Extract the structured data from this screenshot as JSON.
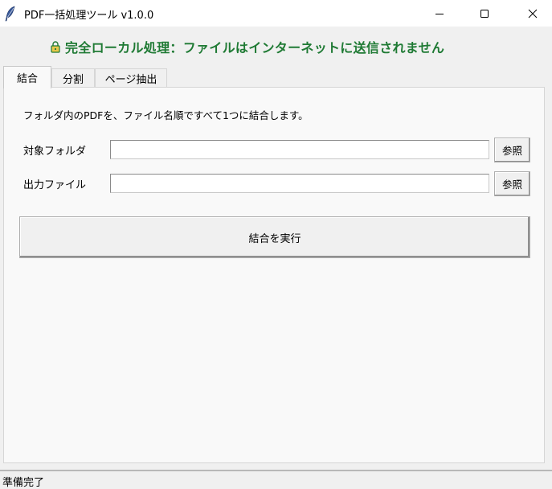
{
  "window": {
    "title": "PDF一括処理ツール v1.0.0",
    "icon": "feather-icon"
  },
  "banner": {
    "icon": "lock-icon",
    "text": "完全ローカル処理：ファイルはインターネットに送信されません",
    "color": "#1f7a34"
  },
  "tabs": [
    {
      "label": "結合",
      "active": true
    },
    {
      "label": "分割",
      "active": false
    },
    {
      "label": "ページ抽出",
      "active": false
    }
  ],
  "merge": {
    "description": "フォルダ内のPDFを、ファイル名順ですべて1つに結合します。",
    "folder_label": "対象フォルダ",
    "folder_value": "",
    "output_label": "出力ファイル",
    "output_value": "",
    "browse_label": "参照",
    "run_label": "結合を実行"
  },
  "status": {
    "text": "準備完了"
  }
}
